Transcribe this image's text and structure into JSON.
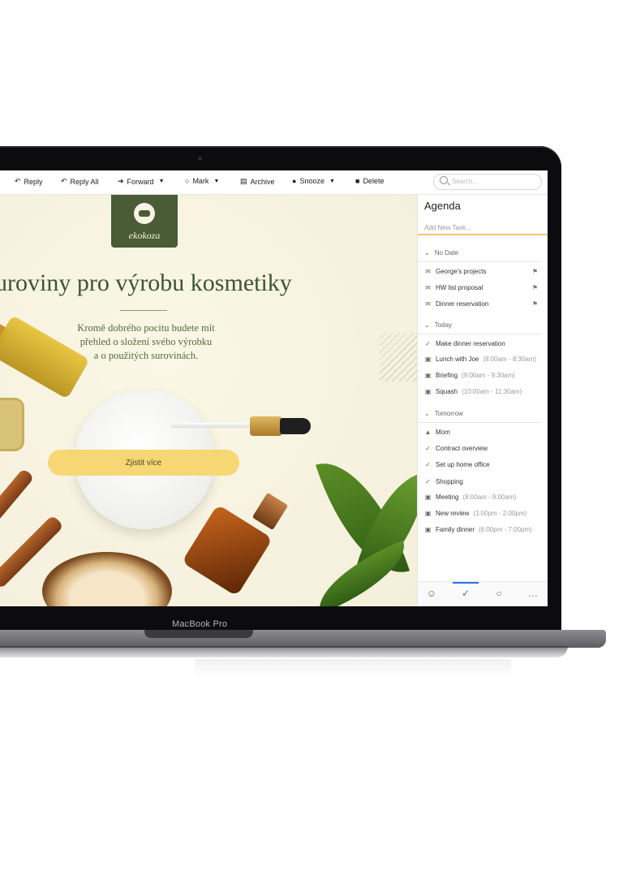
{
  "laptop": {
    "brand": "MacBook Pro"
  },
  "toolbar": {
    "reply": "Reply",
    "reply_all": "Reply All",
    "forward": "Forward",
    "mark": "Mark",
    "archive": "Archive",
    "snooze": "Snooze",
    "delete": "Delete",
    "search_placeholder": "Search..."
  },
  "email": {
    "logo_text": "ekokoza",
    "headline": "uroviny pro výrobu kosmetiky",
    "subtext": [
      "Kromě dobrého pocitu budete mít",
      "přehled o složení svého výrobku",
      "a o použitých surovinách."
    ],
    "cta": "Zjistit více"
  },
  "agenda": {
    "title": "Agenda",
    "add_placeholder": "Add New Task...",
    "sections": {
      "no_date": "No Date",
      "today": "Today",
      "tomorrow": "Tomorrow"
    },
    "no_date": [
      {
        "label": "George's projects",
        "icon": "envelope-icon"
      },
      {
        "label": "HW list proposal",
        "icon": "envelope-icon"
      },
      {
        "label": "Dinner reservation",
        "icon": "envelope-icon"
      }
    ],
    "today": [
      {
        "label": "Make dinner reservation",
        "time": "",
        "icon": "check-icon"
      },
      {
        "label": "Lunch with Joe",
        "time": "(8:00am - 8:30am)",
        "icon": "calendar-icon"
      },
      {
        "label": "Briefing",
        "time": "(9:00am - 9:30am)",
        "icon": "calendar-icon"
      },
      {
        "label": "Squash",
        "time": "(10:00am - 11:30am)",
        "icon": "calendar-icon"
      }
    ],
    "tomorrow": [
      {
        "label": "Mom",
        "time": "",
        "icon": "birthday-cake-icon"
      },
      {
        "label": "Contract overview",
        "time": "",
        "icon": "check-icon"
      },
      {
        "label": "Set up home office",
        "time": "",
        "icon": "check-icon"
      },
      {
        "label": "Shopping",
        "time": "",
        "icon": "check-icon"
      },
      {
        "label": "Meeting",
        "time": "(8:00am - 9:00am)",
        "icon": "calendar-icon"
      },
      {
        "label": "New review",
        "time": "(1:00pm - 2:00pm)",
        "icon": "calendar-icon"
      },
      {
        "label": "Family dinner",
        "time": "(6:00pm - 7:00pm)",
        "icon": "calendar-icon"
      }
    ]
  },
  "colors": {
    "accent": "#2f6fe4",
    "brand_green": "#4a5c35",
    "cta_yellow": "#f7d774",
    "agenda_underline": "#f5c46a"
  }
}
